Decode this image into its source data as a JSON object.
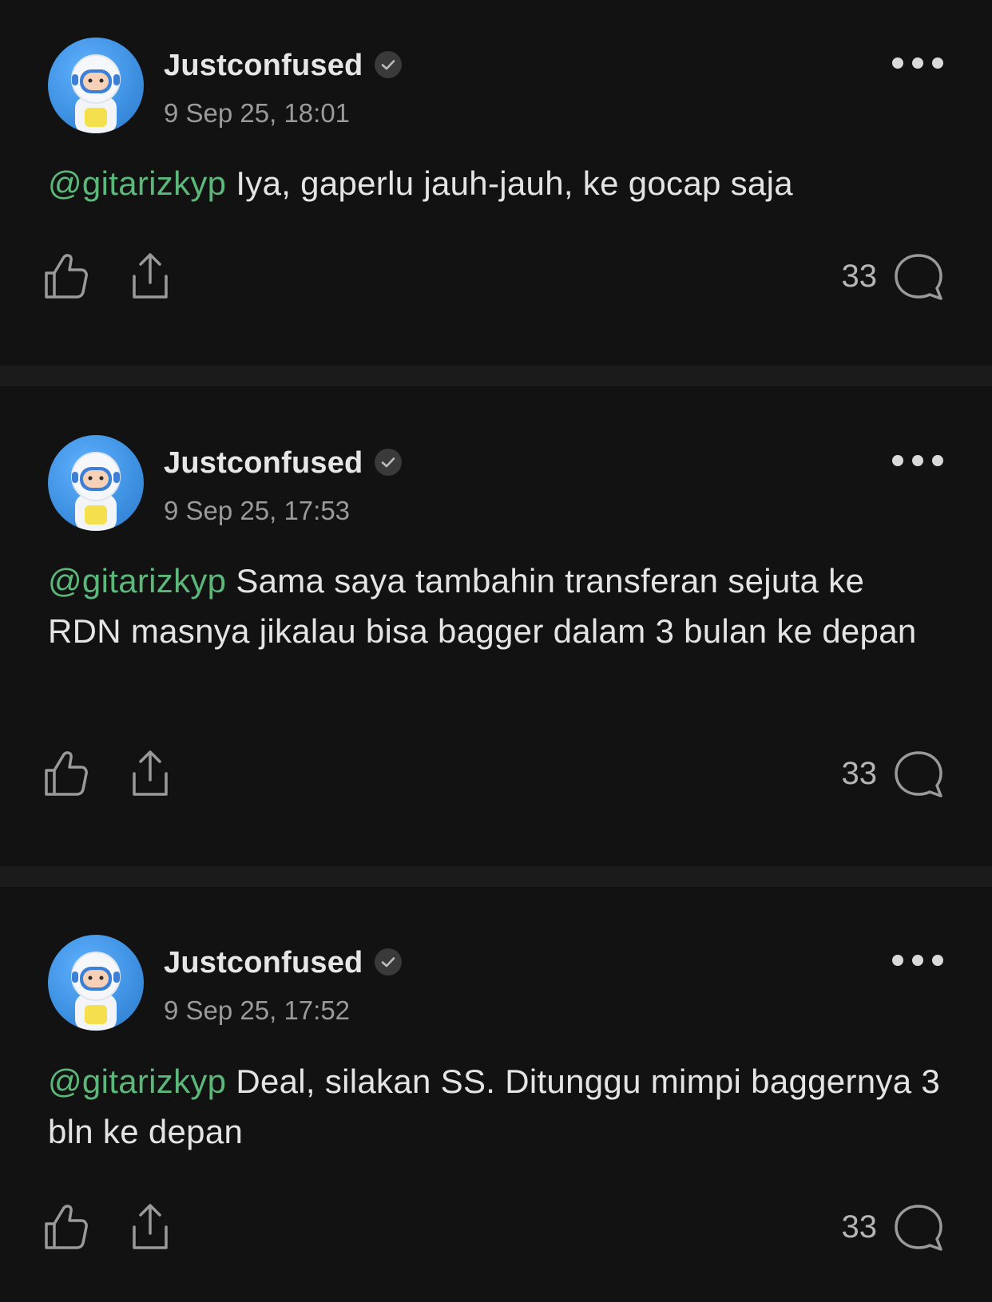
{
  "posts": [
    {
      "username": "Justconfused",
      "timestamp": "9 Sep 25, 18:01",
      "mention": "@gitarizkyp",
      "text": " Iya, gaperlu jauh-jauh, ke gocap saja",
      "reply_count": "33"
    },
    {
      "username": "Justconfused",
      "timestamp": "9 Sep 25, 17:53",
      "mention": "@gitarizkyp",
      "text": " Sama saya tambahin transferan sejuta ke RDN masnya jikalau bisa bagger dalam 3 bulan ke depan",
      "reply_count": "33"
    },
    {
      "username": "Justconfused",
      "timestamp": "9 Sep 25, 17:52",
      "mention": "@gitarizkyp",
      "text": " Deal, silakan SS. Ditunggu mimpi baggernya 3 bln ke depan",
      "reply_count": "33"
    }
  ],
  "colors": {
    "background": "#121212",
    "separator": "#1b1b1b",
    "mention": "#5cb87a",
    "text": "#e4e4e4",
    "muted": "#9a9a9a"
  },
  "icons": {
    "verified": "verified-badge-icon",
    "more": "more-dots-icon",
    "like": "thumbs-up-icon",
    "share": "share-icon",
    "comment": "comment-bubble-icon"
  }
}
